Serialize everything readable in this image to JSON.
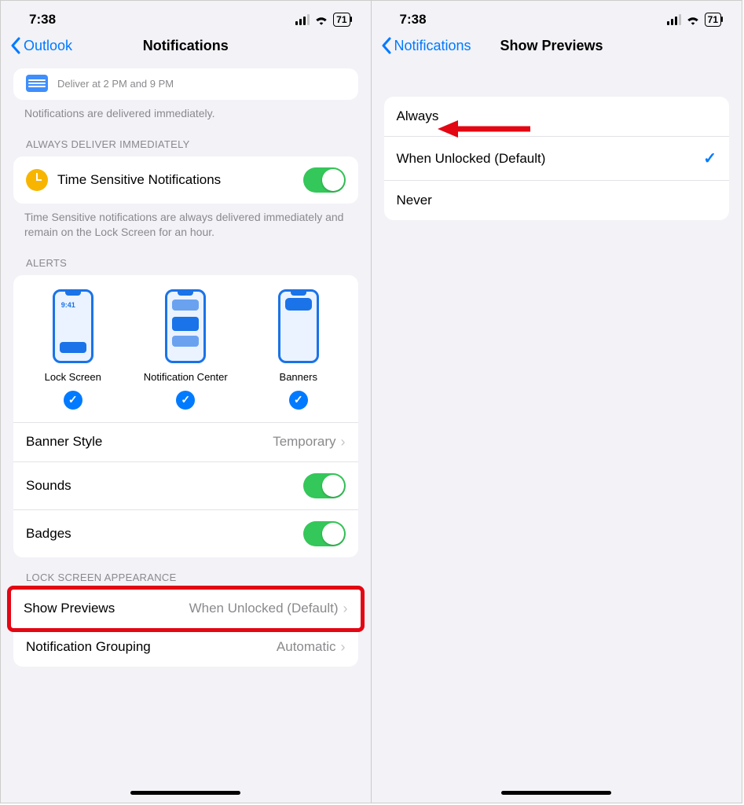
{
  "statusbar": {
    "time": "7:38",
    "battery": "71"
  },
  "left": {
    "back": "Outlook",
    "title": "Notifications",
    "summary_sub": "Deliver at 2 PM and 9 PM",
    "summary_note": "Notifications are delivered immediately.",
    "sections": {
      "always_deliver": "ALWAYS DELIVER IMMEDIATELY",
      "alerts": "ALERTS",
      "lock_appearance": "LOCK SCREEN APPEARANCE"
    },
    "time_sensitive": "Time Sensitive Notifications",
    "time_sensitive_note": "Time Sensitive notifications are always delivered immediately and remain on the Lock Screen for an hour.",
    "alert_items": {
      "lock": "Lock Screen",
      "center": "Notification Center",
      "banners": "Banners",
      "mock_time": "9:41"
    },
    "rows": {
      "banner_style": "Banner Style",
      "banner_style_val": "Temporary",
      "sounds": "Sounds",
      "badges": "Badges",
      "show_previews": "Show Previews",
      "show_previews_val": "When Unlocked (Default)",
      "grouping": "Notification Grouping",
      "grouping_val": "Automatic"
    }
  },
  "right": {
    "back": "Notifications",
    "title": "Show Previews",
    "options": {
      "always": "Always",
      "when_unlocked": "When Unlocked (Default)",
      "never": "Never"
    }
  }
}
